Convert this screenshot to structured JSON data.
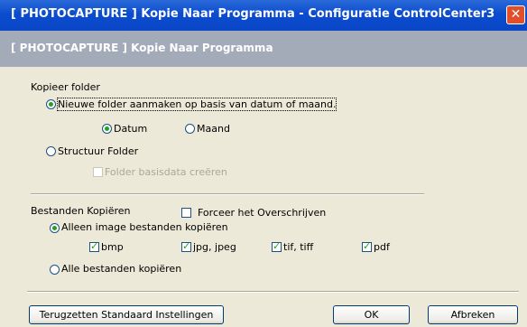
{
  "window": {
    "title": "[ PHOTOCAPTURE ]  Kopie Naar Programma - Configuratie ControlCenter3",
    "close_glyph": "✕"
  },
  "header": {
    "title": "[ PHOTOCAPTURE ]  Kopie Naar Programma"
  },
  "kopieer_folder": {
    "label": "Kopieer folder",
    "new_folder_option": "Nieuwe folder aanmaken op basis van datum of maand.",
    "datum": "Datum",
    "maand": "Maand",
    "structuur": "Structuur Folder",
    "basisdata": "Folder basisdata creëren"
  },
  "bestanden": {
    "label": "Bestanden Kopiëren",
    "overwrite": "Forceer het Overschrijven",
    "image_only": "Alleen image bestanden kopiëren",
    "types": [
      "bmp",
      "jpg, jpeg",
      "tif, tiff",
      "pdf"
    ],
    "all_files": "Alle bestanden kopiëren"
  },
  "buttons": {
    "reset": "Terugzetten Standaard Instellingen",
    "ok": "OK",
    "cancel": "Afbreken"
  },
  "colors": {
    "titlebar": "#0b4ccf",
    "header": "#a3aab8",
    "panel": "#ece9d8",
    "checked": "#21a121"
  }
}
